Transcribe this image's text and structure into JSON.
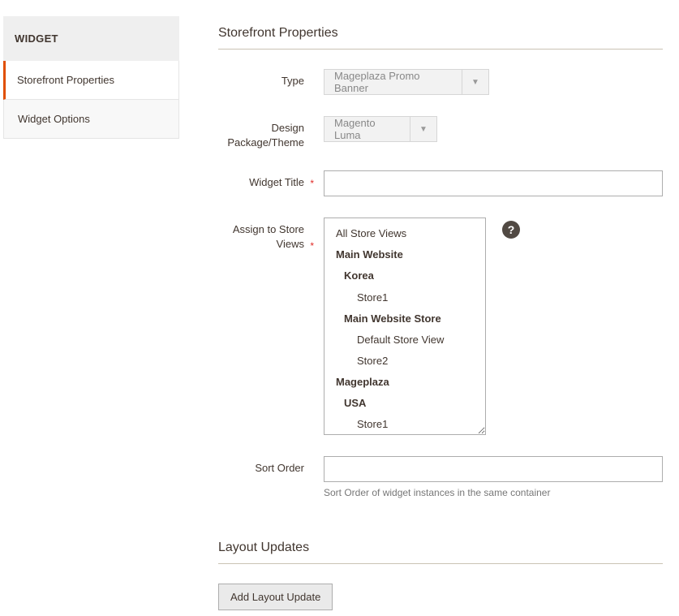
{
  "sidebar": {
    "header": "WIDGET",
    "tabs": [
      {
        "label": "Storefront Properties",
        "active": true
      },
      {
        "label": "Widget Options",
        "active": false
      }
    ]
  },
  "sections": {
    "storefront": {
      "title": "Storefront Properties",
      "fields": {
        "type": {
          "label": "Type",
          "value": "Mageplaza Promo Banner"
        },
        "theme": {
          "label": "Design Package/Theme",
          "value": "Magento Luma"
        },
        "title": {
          "label": "Widget Title",
          "value": ""
        },
        "store_views": {
          "label": "Assign to Store Views",
          "options": [
            {
              "text": "All Store Views",
              "bold": false,
              "level": 0
            },
            {
              "text": "Main Website",
              "bold": true,
              "level": 0
            },
            {
              "text": "Korea",
              "bold": true,
              "level": 1
            },
            {
              "text": "Store1",
              "bold": false,
              "level": 2
            },
            {
              "text": "Main Website Store",
              "bold": true,
              "level": 1
            },
            {
              "text": "Default Store View",
              "bold": false,
              "level": 2
            },
            {
              "text": "Store2",
              "bold": false,
              "level": 2
            },
            {
              "text": "Mageplaza",
              "bold": true,
              "level": 0
            },
            {
              "text": "USA",
              "bold": true,
              "level": 1
            },
            {
              "text": "Store1",
              "bold": false,
              "level": 2
            }
          ]
        },
        "sort_order": {
          "label": "Sort Order",
          "value": "",
          "hint": "Sort Order of widget instances in the same container"
        }
      }
    },
    "layout_updates": {
      "title": "Layout Updates",
      "button": "Add Layout Update"
    }
  },
  "required_mark": "*",
  "help_glyph": "?"
}
